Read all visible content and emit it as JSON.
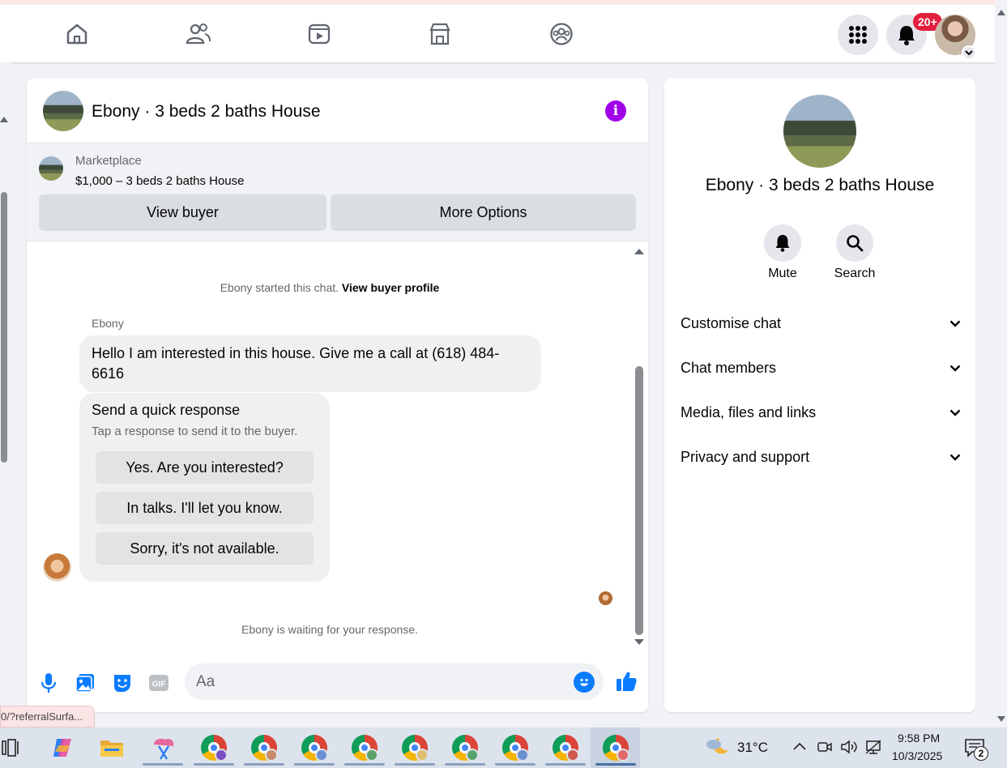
{
  "nav": {
    "items": [
      "home-icon",
      "friends-icon",
      "video-icon",
      "marketplace-icon",
      "groups-icon"
    ],
    "notification_count": "20+"
  },
  "chat": {
    "title": "Ebony · 3 beds 2 baths House",
    "marketplace_label": "Marketplace",
    "listing": "$1,000 – 3 beds 2 baths House",
    "view_buyer": "View buyer",
    "more_options": "More Options",
    "started_text": "Ebony started this chat.",
    "view_profile": "View buyer profile",
    "sender": "Ebony",
    "message": "Hello I am interested in this house. Give me a call at (618) 484-6616",
    "quick_title": "Send a quick response",
    "quick_sub": "Tap a response to send it to the buyer.",
    "quick_responses": [
      "Yes. Are you interested?",
      "In talks. I'll let you know.",
      "Sorry, it's not available."
    ],
    "waiting": "Ebony is waiting for your response.",
    "input_placeholder": "Aa"
  },
  "right": {
    "title": "Ebony · 3 beds 2 baths House",
    "mute": "Mute",
    "search": "Search",
    "sections": [
      "Customise chat",
      "Chat members",
      "Media, files and links",
      "Privacy and support"
    ]
  },
  "status_url": "0/?referralSurfa...",
  "taskbar": {
    "weather": "31°C",
    "time": "9:58 PM",
    "date": "10/3/2025",
    "notifications": "2"
  },
  "colors": {
    "accent": "#0a7cff",
    "info": "#a000e8",
    "badge": "#e41e3f"
  }
}
